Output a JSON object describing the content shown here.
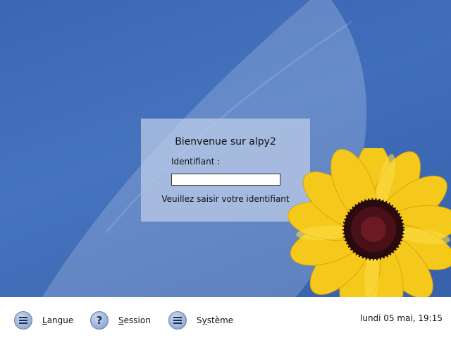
{
  "login": {
    "welcome": "Bienvenue sur alpy2",
    "username_label": "Identifiant :",
    "username_value": "",
    "prompt": "Veuillez saisir votre identifiant"
  },
  "bottom_bar": {
    "langue": {
      "mnemonic": "L",
      "rest": "angue",
      "icon": "menu-lines-icon"
    },
    "session": {
      "mnemonic": "S",
      "rest": "ession",
      "icon": "question-mark-icon"
    },
    "systeme": {
      "before": "S",
      "mnemonic": "y",
      "rest": "stème",
      "icon": "menu-lines-icon"
    },
    "clock": "lundi 05 mai, 19:15"
  },
  "colors": {
    "background": "#3f6bb5",
    "login_box": "#becde8",
    "flower_petal": "#f7cf1e",
    "flower_center": "#3a0c10"
  }
}
